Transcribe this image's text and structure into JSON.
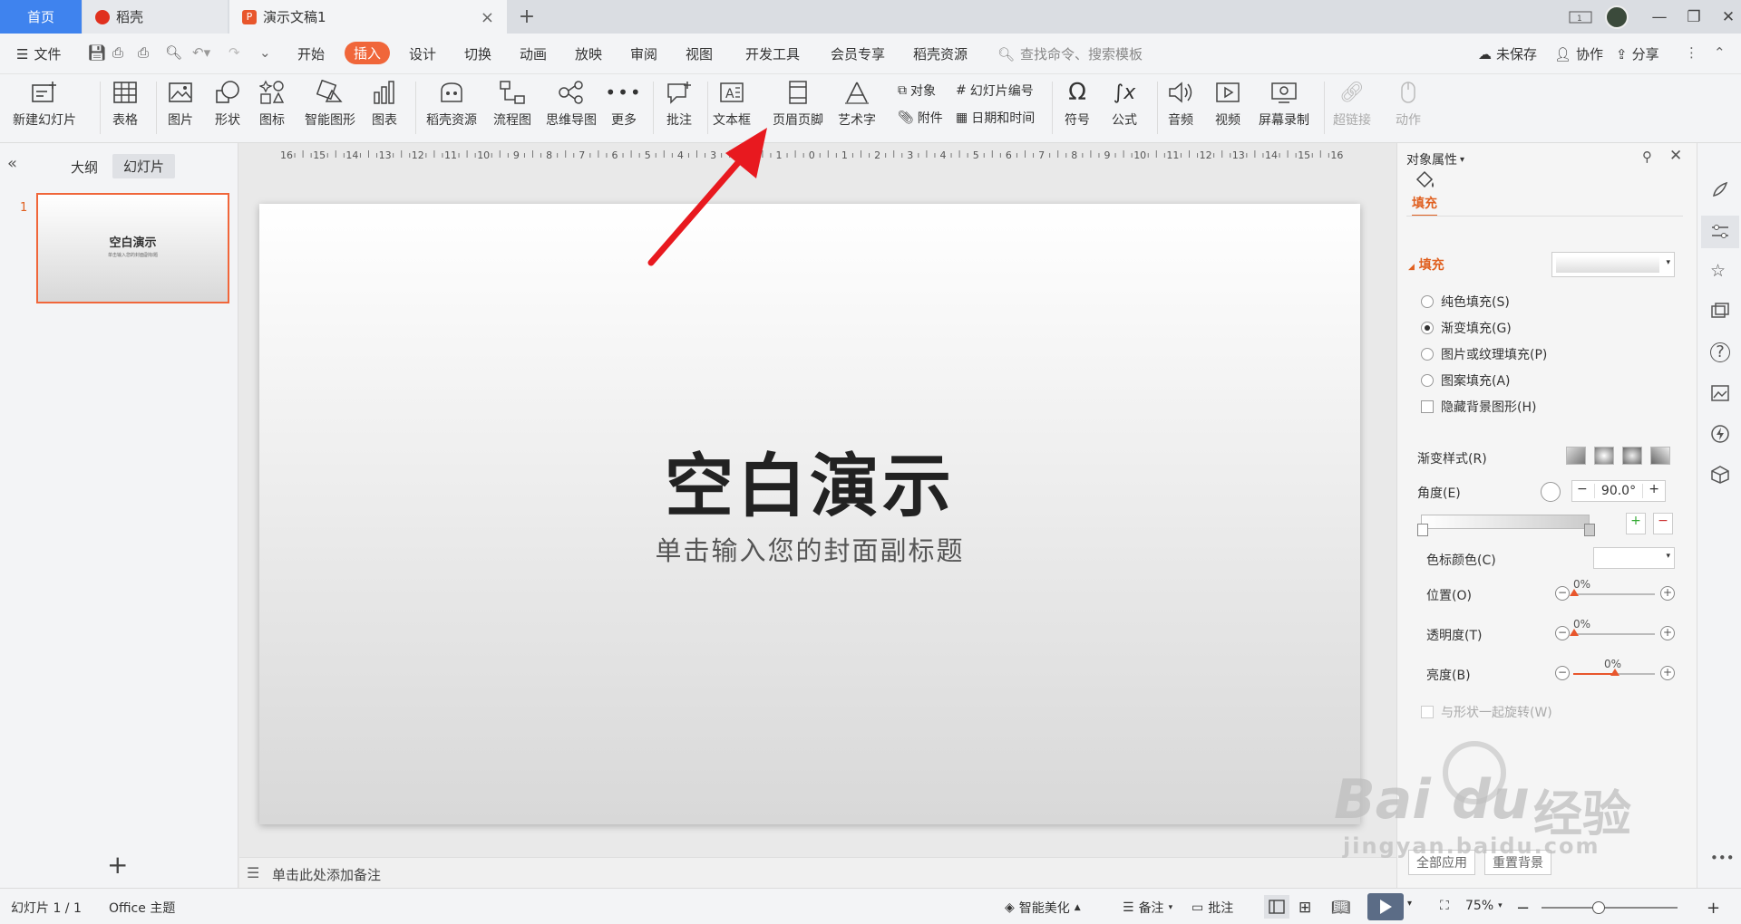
{
  "tabs": {
    "home": "首页",
    "daoke": "稻壳",
    "doc": "演示文稿1",
    "new_tab": "+"
  },
  "menubar": {
    "file": "文件",
    "items": [
      "开始",
      "插入",
      "设计",
      "切换",
      "动画",
      "放映",
      "审阅",
      "视图",
      "开发工具",
      "会员专享",
      "稻壳资源"
    ],
    "active_item": "插入",
    "search": "查找命令、搜索模板",
    "unsaved": "未保存",
    "collab": "协作",
    "share": "分享"
  },
  "ribbon": {
    "new_slide": "新建幻灯片",
    "table": "表格",
    "picture": "图片",
    "shape": "形状",
    "icon": "图标",
    "smartart": "智能图形",
    "chart": "图表",
    "daoke_res": "稻壳资源",
    "flowchart": "流程图",
    "mindmap": "思维导图",
    "more": "更多",
    "comment": "批注",
    "textbox": "文本框",
    "header_footer": "页眉页脚",
    "wordart": "艺术字",
    "object": "对象",
    "attachment": "附件",
    "slide_number": "幻灯片编号",
    "datetime": "日期和时间",
    "symbol": "符号",
    "formula": "公式",
    "audio": "音频",
    "video": "视频",
    "screen_record": "屏幕录制",
    "hyperlink": "超链接",
    "action": "动作"
  },
  "leftpanel": {
    "outline_tab": "大纲",
    "slides_tab": "幻灯片",
    "slide_index": "1",
    "thumb_title": "空白演示",
    "thumb_sub": "单击输入您的封面副标题",
    "add": "+"
  },
  "ruler": [
    "16",
    "15",
    "14",
    "13",
    "12",
    "11",
    "10",
    "9",
    "8",
    "7",
    "6",
    "5",
    "4",
    "3",
    "2",
    "1",
    "0",
    "1",
    "2",
    "3",
    "4",
    "5",
    "6",
    "7",
    "8",
    "9",
    "10",
    "11",
    "12",
    "13",
    "14",
    "15",
    "16"
  ],
  "slide": {
    "title": "空白演示",
    "subtitle": "单击输入您的封面副标题"
  },
  "notes": {
    "placeholder": "单击此处添加备注"
  },
  "rightpanel": {
    "header": "对象属性",
    "tab_fill": "填充",
    "section_fill": "填充",
    "options": [
      "纯色填充(S)",
      "渐变填充(G)",
      "图片或纹理填充(P)",
      "图案填充(A)"
    ],
    "selected_option": "渐变填充(G)",
    "hide_bg": "隐藏背景图形(H)",
    "gradient_style": "渐变样式(R)",
    "angle_label": "角度(E)",
    "angle_value": "90.0°",
    "stop_color": "色标颜色(C)",
    "position_label": "位置(O)",
    "position_value": "0%",
    "transparency_label": "透明度(T)",
    "transparency_value": "0%",
    "brightness_label": "亮度(B)",
    "brightness_value": "0%",
    "rotate_with_shape": "与形状一起旋转(W)",
    "apply_all": "全部应用",
    "reset_bg": "重置背景"
  },
  "statusbar": {
    "slide_info": "幻灯片 1 / 1",
    "theme": "Office 主题",
    "beautify": "智能美化",
    "notes": "备注",
    "comment": "批注",
    "zoom": "75%"
  },
  "watermark": {
    "brand": "Bai",
    "brand2": "du",
    "cn": "经验",
    "url": "jingyan.baidu.com"
  },
  "colors": {
    "accent": "#f0663a",
    "home_tab": "#3f83ee",
    "arrow": "#e8191f"
  }
}
